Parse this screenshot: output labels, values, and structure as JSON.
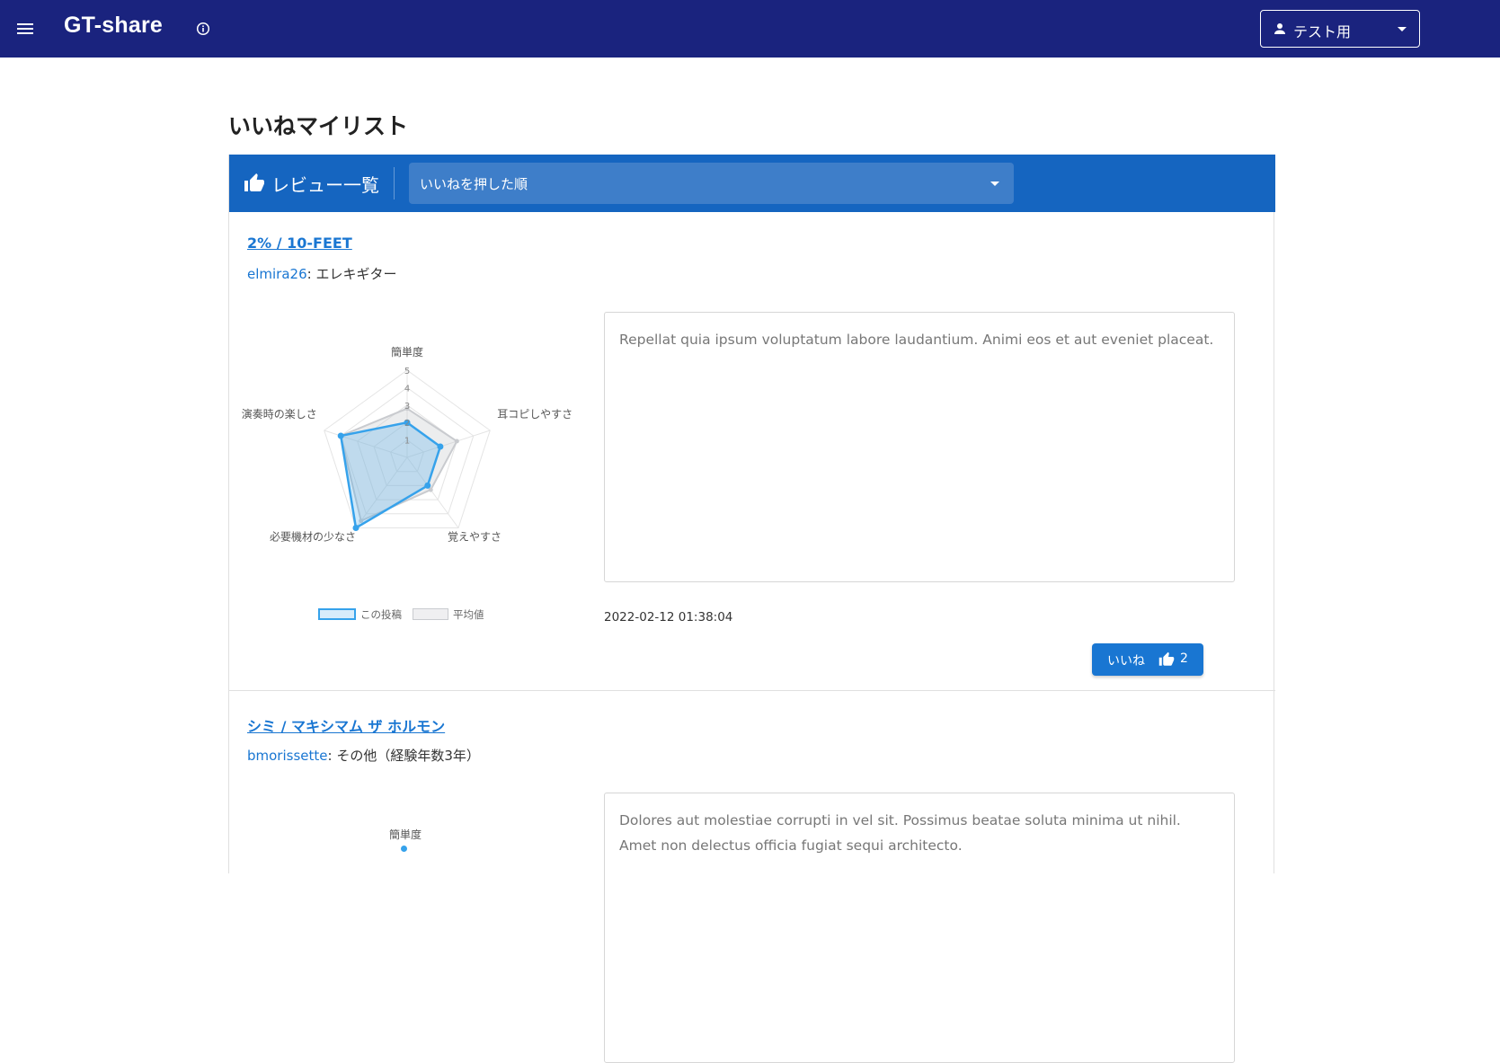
{
  "appbar": {
    "title": "GT-share",
    "user_label": "テスト用",
    "bg_color": "#1a237e"
  },
  "page": {
    "title": "いいねマイリスト"
  },
  "toolbar": {
    "title": "レビュー一覧",
    "sort_selected": "いいねを押した順",
    "bg_color": "#1565c0"
  },
  "reviews": [
    {
      "song": "2% / 10-FEET",
      "author": "elmira26",
      "instrument": ": エレキギター",
      "comment": "Repellat quia ipsum voluptatum labore laudantium. Animi eos et aut eveniet placeat.",
      "created_at": "2022-02-12 01:38:04",
      "like_label": "いいね",
      "like_count": "2",
      "chart_data": {
        "type": "radar",
        "axes": [
          "簡単度",
          "耳コピしやすさ",
          "覚えやすさ",
          "必要機材の少なさ",
          "演奏時の楽しさ"
        ],
        "scale_ticks": [
          "1",
          "2",
          "3",
          "4",
          "5"
        ],
        "range": [
          0,
          5
        ],
        "series": [
          {
            "name": "この投稿",
            "values": [
              2,
              2,
              2,
              5,
              4
            ],
            "color": "#36a2eb"
          },
          {
            "name": "平均値",
            "values": [
              2.8,
              3,
              2.3,
              4.5,
              4
            ],
            "color": "#c9cbcf"
          }
        ]
      }
    },
    {
      "song": "シミ / マキシマム ザ ホルモン",
      "author": "bmorissette",
      "instrument": ": その他（経験年数3年）",
      "comment": "Dolores aut molestiae corrupti in vel sit. Possimus beatae soluta minima ut nihil. Amet non delectus officia fugiat sequi architecto.",
      "chart_top_label": "簡単度"
    }
  ]
}
